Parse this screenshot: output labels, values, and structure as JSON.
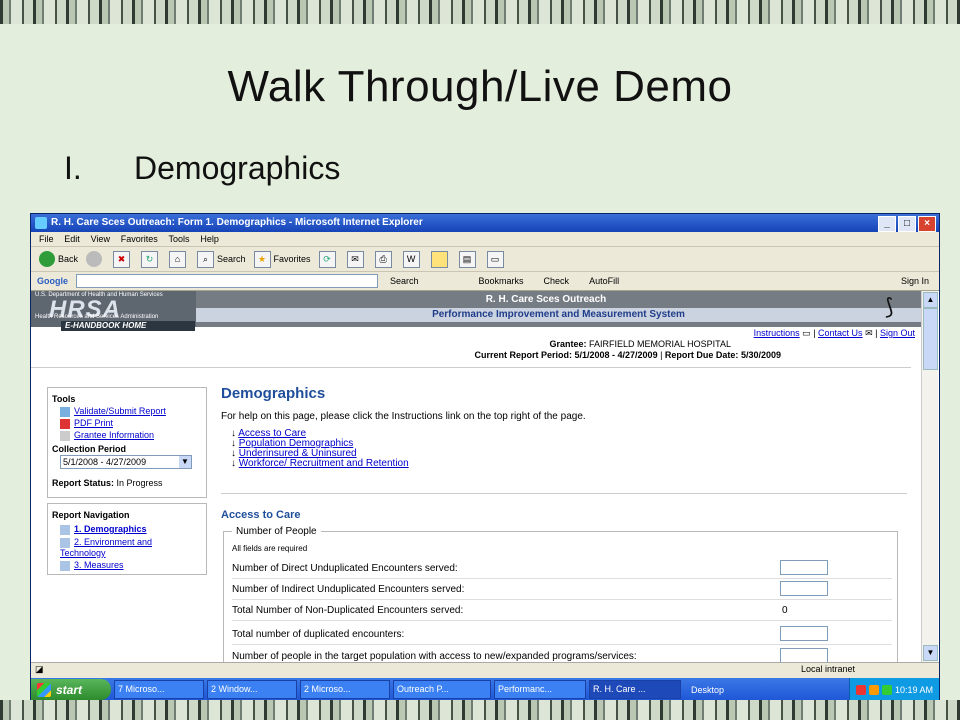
{
  "slide": {
    "title": "Walk Through/Live Demo",
    "bullet_number": "I.",
    "bullet_text": "Demographics"
  },
  "browser": {
    "window_title": "R. H. Care Sces Outreach: Form 1. Demographics - Microsoft Internet Explorer",
    "menu": [
      "File",
      "Edit",
      "View",
      "Favorites",
      "Tools",
      "Help"
    ],
    "toolbar": {
      "back": "Back",
      "search": "Search",
      "favorites": "Favorites"
    },
    "google_bar": {
      "label": "Google",
      "search": "Search",
      "bookmarks": "Bookmarks",
      "check": "Check",
      "autofill": "AutoFill",
      "signin": "Sign In"
    }
  },
  "site": {
    "logo_gov": "U.S. Department of Health and Human Services",
    "logo_text": "HRSA",
    "logo_sub": "Health Resources and Services Administration",
    "ehandbook": "E-HANDBOOK HOME",
    "title": "R. H. Care Sces Outreach",
    "subtitle": "Performance Improvement and Measurement System",
    "links": {
      "instructions": "Instructions",
      "contact": "Contact Us",
      "signout": "Sign Out"
    },
    "grantee_label": "Grantee:",
    "grantee_value": "FAIRFIELD MEMORIAL HOSPITAL",
    "period_label": "Current Report Period:",
    "period_value": "5/1/2008 - 4/27/2009",
    "due_label": "Report Due Date:",
    "due_value": "5/30/2009"
  },
  "tools": {
    "heading": "Tools",
    "items": [
      "Validate/Submit Report",
      "PDF Print",
      "Grantee Information"
    ],
    "collection_label": "Collection Period",
    "collection_value": "5/1/2008 - 4/27/2009",
    "status_label": "Report Status:",
    "status_value": "In Progress"
  },
  "report_nav": {
    "heading": "Report Navigation",
    "items": [
      "1. Demographics",
      "2. Environment and Technology",
      "3. Measures"
    ]
  },
  "main": {
    "heading": "Demographics",
    "help": "For help on this page, please click the Instructions link on the top right of the page.",
    "anchors": [
      "Access to Care",
      "Population Demographics",
      "Underinsured & Uninsured",
      "Workforce/ Recruitment and Retention"
    ],
    "section": "Access to Care",
    "fieldset_legend": "Number of People",
    "required_note": "All fields are required",
    "rows": [
      {
        "label": "Number of Direct Unduplicated Encounters served:",
        "value": ""
      },
      {
        "label": "Number of Indirect Unduplicated Encounters served:",
        "value": ""
      },
      {
        "label": "Total Number of Non-Duplicated Encounters served:",
        "value": "0"
      },
      {
        "label": "Total number of duplicated encounters:",
        "value": ""
      },
      {
        "label": "Number of people in the target population with access to new/expanded programs/services:",
        "value": ""
      }
    ]
  },
  "statusbar": {
    "zone": "Local intranet"
  },
  "taskbar": {
    "start": "start",
    "tasks": [
      "7 Microso...",
      "2 Window...",
      "2 Microso...",
      "Outreach P...",
      "Performanc...",
      "R. H. Care ..."
    ],
    "desktop": "Desktop",
    "clock": "10:19 AM"
  }
}
